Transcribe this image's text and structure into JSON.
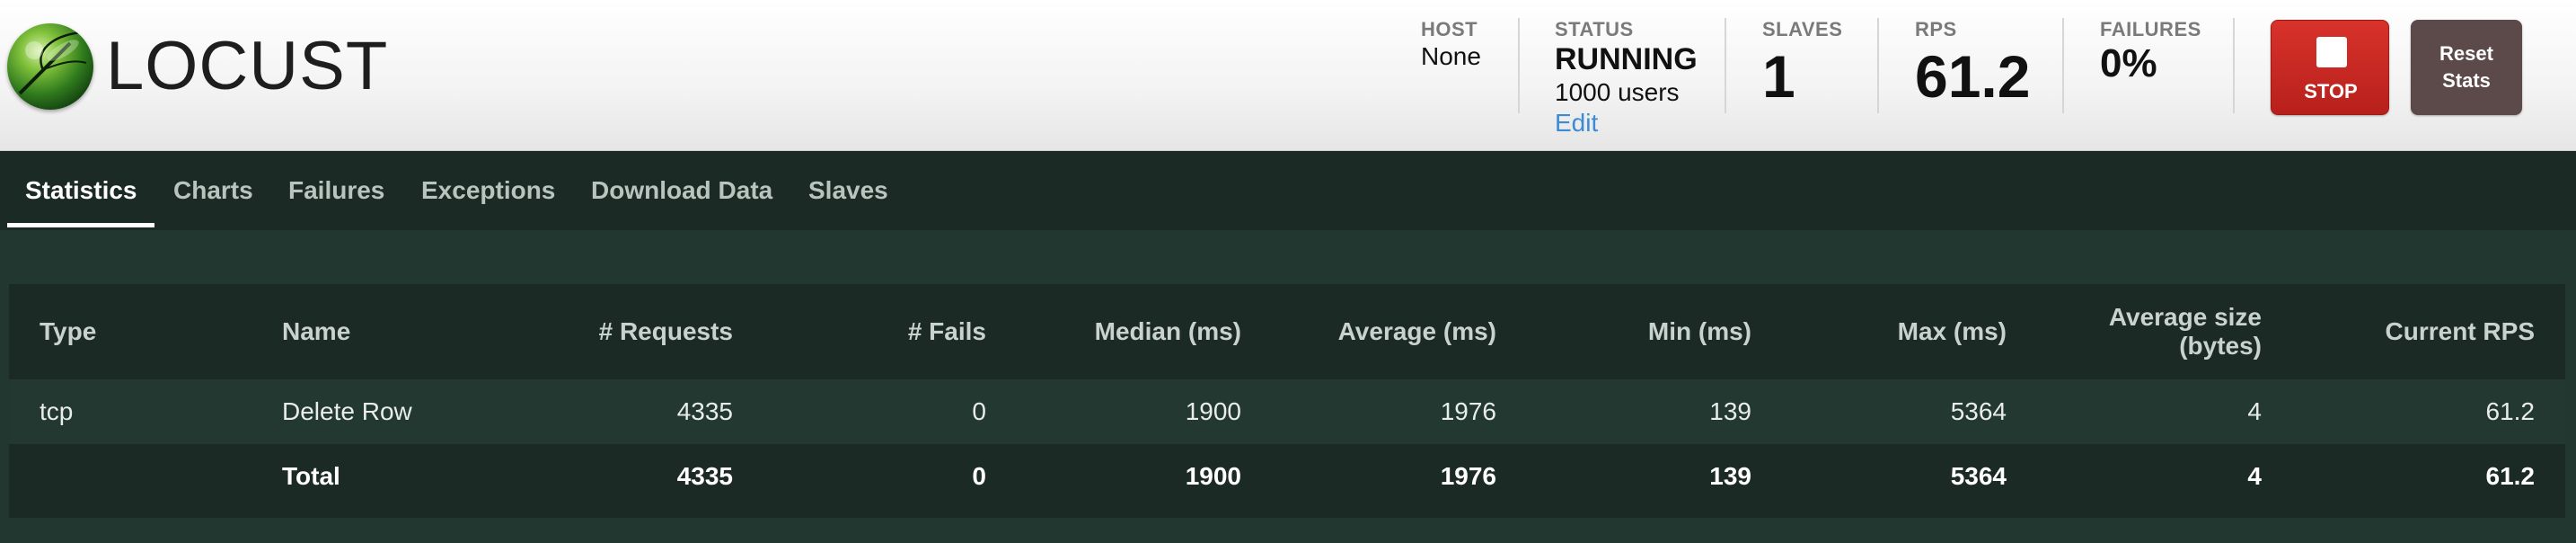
{
  "app": {
    "logo_text": "LOCUST"
  },
  "header": {
    "host": {
      "label": "HOST",
      "value": "None"
    },
    "status": {
      "label": "STATUS",
      "value": "RUNNING",
      "users": "1000 users",
      "edit_label": "Edit"
    },
    "slaves": {
      "label": "SLAVES",
      "value": "1"
    },
    "rps": {
      "label": "RPS",
      "value": "61.2"
    },
    "failures": {
      "label": "FAILURES",
      "value": "0%"
    },
    "stop_label": "STOP",
    "reset_label": "Reset Stats"
  },
  "nav": {
    "tabs": [
      "Statistics",
      "Charts",
      "Failures",
      "Exceptions",
      "Download Data",
      "Slaves"
    ],
    "active": "Statistics"
  },
  "table": {
    "columns": [
      "Type",
      "Name",
      "# Requests",
      "# Fails",
      "Median (ms)",
      "Average (ms)",
      "Min (ms)",
      "Max (ms)",
      "Average size (bytes)",
      "Current RPS"
    ],
    "rows": [
      [
        "tcp",
        "Delete Row",
        "4335",
        "0",
        "1900",
        "1976",
        "139",
        "5364",
        "4",
        "61.2"
      ]
    ],
    "total": [
      "",
      "Total",
      "4335",
      "0",
      "1900",
      "1976",
      "139",
      "5364",
      "4",
      "61.2"
    ]
  },
  "colors": {
    "header_bg": "#f3f3f3",
    "nav_bg": "#1b2a24",
    "content_bg": "#213730",
    "stop_button": "#c9291f",
    "reset_button": "#5c4a4a",
    "link": "#3b8bd6"
  }
}
